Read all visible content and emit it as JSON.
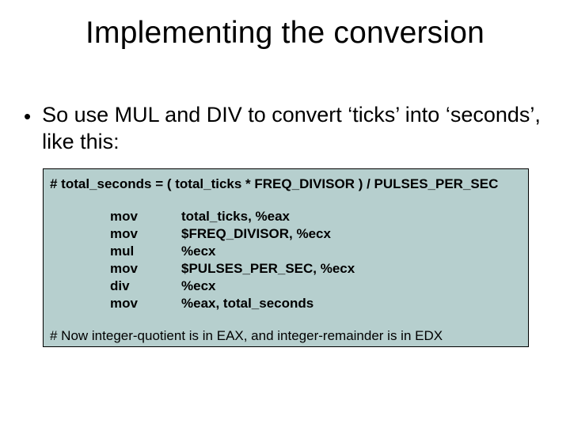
{
  "title": "Implementing the conversion",
  "bullet": {
    "marker": "•",
    "text": "So use MUL and DIV to convert ‘ticks’ into ‘seconds’, like this:"
  },
  "code": {
    "comment_top": "#   total_seconds = ( total_ticks * FREQ_DIVISOR ) / PULSES_PER_SEC",
    "asm": [
      {
        "mnemonic": "mov",
        "operands": "total_ticks, %eax"
      },
      {
        "mnemonic": "mov",
        "operands": "$FREQ_DIVISOR, %ecx"
      },
      {
        "mnemonic": "mul",
        "operands": "%ecx"
      },
      {
        "mnemonic": "mov",
        "operands": "$PULSES_PER_SEC, %ecx"
      },
      {
        "mnemonic": "div",
        "operands": "%ecx"
      },
      {
        "mnemonic": "mov",
        "operands": "%eax, total_seconds"
      }
    ],
    "comment_bottom": "# Now integer-quotient is in EAX, and integer-remainder is in EDX"
  }
}
